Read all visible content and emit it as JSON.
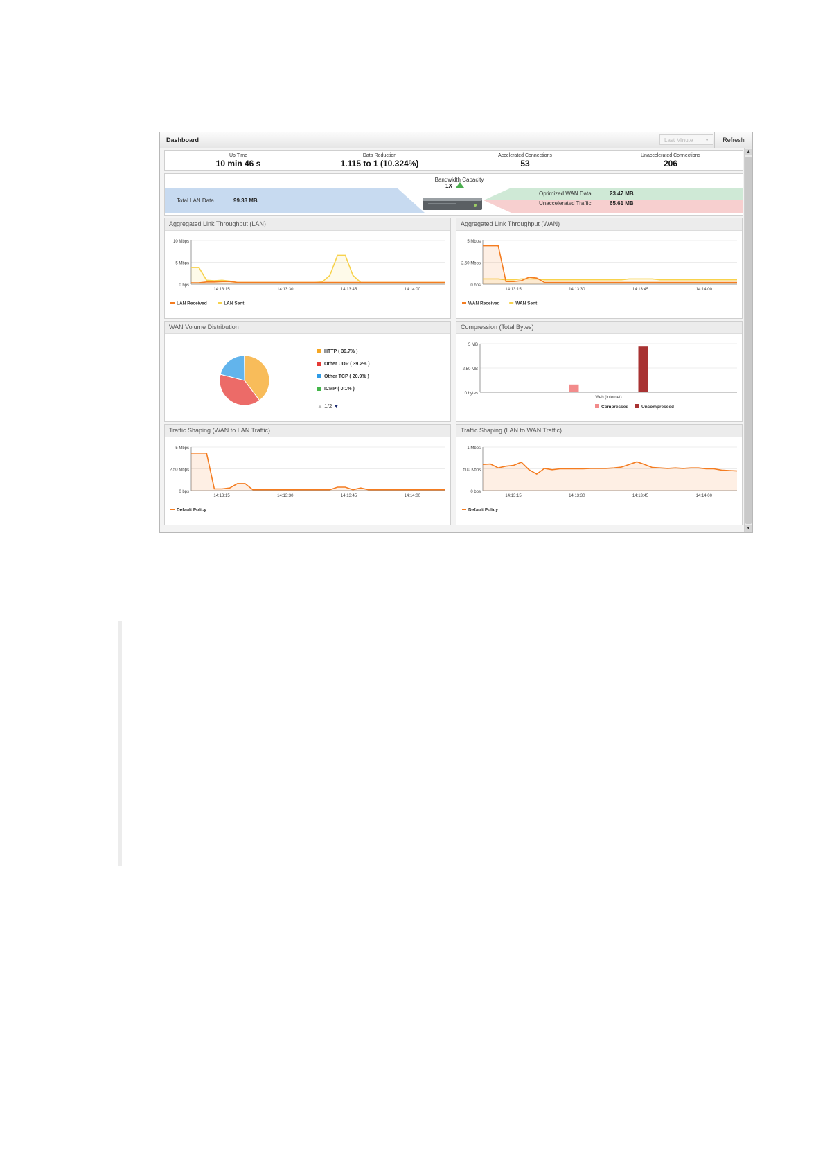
{
  "dashboard": {
    "title": "Dashboard",
    "range_select": "Last Minute",
    "refresh": "Refresh"
  },
  "stats": [
    {
      "label": "Up Time",
      "value": "10 min 46 s"
    },
    {
      "label": "Data Reduction",
      "value": "1.115 to 1 (10.324%)"
    },
    {
      "label": "Accelerated Connections",
      "value": "53"
    },
    {
      "label": "Unaccelerated Connections",
      "value": "206"
    }
  ],
  "flow": {
    "total_lan_label": "Total LAN Data",
    "total_lan_value": "99.33 MB",
    "bandwidth_label": "Bandwidth Capacity",
    "bandwidth_value": "1X",
    "optimized_label": "Optimized WAN Data",
    "optimized_value": "23.47 MB",
    "unaccelerated_label": "Unaccelerated Traffic",
    "unaccelerated_value": "65.61 MB",
    "colors": {
      "lan": "#c7daf0",
      "optimized": "#cfe9d6",
      "unaccelerated": "#f7cfcf"
    }
  },
  "panels": {
    "lan_throughput": "Aggregated Link Throughput (LAN)",
    "wan_throughput": "Aggregated Link Throughput (WAN)",
    "wan_volume": "WAN Volume Distribution",
    "compression": "Compression (Total Bytes)",
    "shaping_wan_lan": "Traffic Shaping (WAN to LAN Traffic)",
    "shaping_lan_wan": "Traffic Shaping (LAN to WAN Traffic)"
  },
  "pie": {
    "items": [
      {
        "label": "HTTP ( 39.7% )",
        "color": "#f5a623"
      },
      {
        "label": "Other UDP ( 39.2% )",
        "color": "#e53935"
      },
      {
        "label": "Other TCP ( 20.9% )",
        "color": "#2e9be6"
      },
      {
        "label": "ICMP ( 0.1% )",
        "color": "#43b649"
      }
    ],
    "pager": "1/2"
  },
  "chart_data": [
    {
      "type": "line",
      "title": "Aggregated Link Throughput (LAN)",
      "ylabel": "",
      "yticks": [
        "10 Mbps",
        "5 Mbps",
        "0 bps"
      ],
      "ylim": [
        0,
        10
      ],
      "xticks": [
        "14:13:15",
        "14:13:30",
        "14:13:45",
        "14:14:00"
      ],
      "x": [
        0,
        2,
        4,
        6,
        8,
        10,
        12,
        14,
        16,
        18,
        20,
        22,
        24,
        26,
        28,
        30,
        32,
        34,
        36,
        38,
        40,
        42,
        44,
        46,
        48,
        50,
        52,
        54,
        56,
        58,
        60,
        62,
        64,
        66
      ],
      "series": [
        {
          "name": "LAN Received",
          "color": "#f47c20",
          "values": [
            0.3,
            0.3,
            0.5,
            0.5,
            0.6,
            0.6,
            0.4,
            0.4,
            0.4,
            0.4,
            0.4,
            0.4,
            0.4,
            0.4,
            0.4,
            0.4,
            0.4,
            0.4,
            0.4,
            0.4,
            0.4,
            0.4,
            0.4,
            0.4,
            0.4,
            0.4,
            0.4,
            0.4,
            0.4,
            0.4,
            0.4,
            0.4,
            0.4,
            0.4
          ]
        },
        {
          "name": "LAN Sent",
          "color": "#f7d24c",
          "values": [
            3.8,
            3.8,
            0.9,
            0.8,
            0.9,
            0.7,
            0.4,
            0.4,
            0.4,
            0.4,
            0.4,
            0.4,
            0.4,
            0.4,
            0.4,
            0.4,
            0.4,
            0.5,
            2.0,
            6.6,
            6.6,
            2.0,
            0.4,
            0.4,
            0.4,
            0.4,
            0.4,
            0.4,
            0.4,
            0.4,
            0.4,
            0.4,
            0.4,
            0.4
          ]
        }
      ]
    },
    {
      "type": "line",
      "title": "Aggregated Link Throughput (WAN)",
      "yticks": [
        "5 Mbps",
        "2.50 Mbps",
        "0 bps"
      ],
      "ylim": [
        0,
        5
      ],
      "xticks": [
        "14:13:15",
        "14:13:30",
        "14:13:45",
        "14:14:00"
      ],
      "x": [
        0,
        2,
        4,
        6,
        8,
        10,
        12,
        14,
        16,
        18,
        20,
        22,
        24,
        26,
        28,
        30,
        32,
        34,
        36,
        38,
        40,
        42,
        44,
        46,
        48,
        50,
        52,
        54,
        56,
        58,
        60,
        62,
        64,
        66
      ],
      "series": [
        {
          "name": "WAN Received",
          "color": "#f47c20",
          "values": [
            4.4,
            4.4,
            4.4,
            0.3,
            0.3,
            0.4,
            0.8,
            0.7,
            0.2,
            0.2,
            0.2,
            0.2,
            0.2,
            0.2,
            0.2,
            0.2,
            0.2,
            0.2,
            0.2,
            0.2,
            0.2,
            0.2,
            0.2,
            0.2,
            0.2,
            0.2,
            0.2,
            0.2,
            0.2,
            0.2,
            0.2,
            0.2,
            0.2,
            0.2
          ]
        },
        {
          "name": "WAN Sent",
          "color": "#f7d24c",
          "values": [
            0.6,
            0.6,
            0.6,
            0.5,
            0.5,
            0.6,
            0.6,
            0.6,
            0.5,
            0.5,
            0.5,
            0.5,
            0.5,
            0.5,
            0.5,
            0.5,
            0.5,
            0.5,
            0.5,
            0.6,
            0.6,
            0.6,
            0.6,
            0.5,
            0.5,
            0.5,
            0.5,
            0.5,
            0.5,
            0.5,
            0.5,
            0.5,
            0.5,
            0.5
          ]
        }
      ]
    },
    {
      "type": "pie",
      "title": "WAN Volume Distribution",
      "labels": [
        "HTTP",
        "Other UDP",
        "Other TCP",
        "ICMP"
      ],
      "values": [
        39.7,
        39.2,
        20.9,
        0.1
      ],
      "colors": [
        "#f5a623",
        "#e53935",
        "#2e9be6",
        "#43b649"
      ]
    },
    {
      "type": "bar",
      "title": "Compression (Total Bytes)",
      "yticks": [
        "5 MB",
        "2.50 MB",
        "0 bytes"
      ],
      "ylim": [
        0,
        5
      ],
      "categories": [
        "Web (Internet)"
      ],
      "series": [
        {
          "name": "Compressed",
          "color": "#f28b8b",
          "values": [
            0.8
          ]
        },
        {
          "name": "Uncompressed",
          "color": "#a83232",
          "values": [
            4.7
          ]
        }
      ]
    },
    {
      "type": "line",
      "title": "Traffic Shaping (WAN to LAN Traffic)",
      "yticks": [
        "5 Mbps",
        "2.50 Mbps",
        "0 bps"
      ],
      "ylim": [
        0,
        5
      ],
      "xticks": [
        "14:13:15",
        "14:13:30",
        "14:13:45",
        "14:14:00"
      ],
      "x": [
        0,
        2,
        4,
        6,
        8,
        10,
        12,
        14,
        16,
        18,
        20,
        22,
        24,
        26,
        28,
        30,
        32,
        34,
        36,
        38,
        40,
        42,
        44,
        46,
        48,
        50,
        52,
        54,
        56,
        58,
        60,
        62,
        64,
        66
      ],
      "series": [
        {
          "name": "Default Policy",
          "color": "#f47c20",
          "values": [
            4.3,
            4.3,
            4.3,
            0.2,
            0.2,
            0.3,
            0.8,
            0.8,
            0.1,
            0.1,
            0.1,
            0.1,
            0.1,
            0.1,
            0.1,
            0.1,
            0.1,
            0.1,
            0.1,
            0.4,
            0.4,
            0.1,
            0.3,
            0.1,
            0.1,
            0.1,
            0.1,
            0.1,
            0.1,
            0.1,
            0.1,
            0.1,
            0.1,
            0.1
          ]
        }
      ]
    },
    {
      "type": "line",
      "title": "Traffic Shaping (LAN to WAN Traffic)",
      "yticks": [
        "1 Mbps",
        "500 Kbps",
        "0 bps"
      ],
      "ylim": [
        0,
        1000
      ],
      "xticks": [
        "14:13:15",
        "14:13:30",
        "14:13:45",
        "14:14:00"
      ],
      "x": [
        0,
        2,
        4,
        6,
        8,
        10,
        12,
        14,
        16,
        18,
        20,
        22,
        24,
        26,
        28,
        30,
        32,
        34,
        36,
        38,
        40,
        42,
        44,
        46,
        48,
        50,
        52,
        54,
        56,
        58,
        60,
        62,
        64,
        66
      ],
      "series": [
        {
          "name": "Default Policy",
          "color": "#f47c20",
          "values": [
            600,
            610,
            520,
            560,
            580,
            650,
            480,
            380,
            510,
            480,
            500,
            500,
            500,
            500,
            510,
            510,
            510,
            520,
            540,
            600,
            660,
            600,
            530,
            520,
            510,
            520,
            510,
            520,
            520,
            500,
            500,
            470,
            460,
            450
          ]
        }
      ]
    }
  ]
}
